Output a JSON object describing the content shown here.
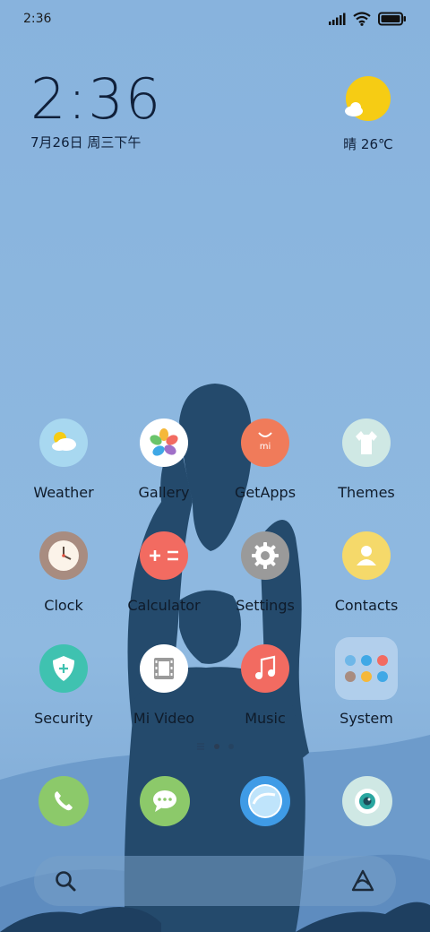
{
  "status_bar": {
    "time": "2:36"
  },
  "clock_widget": {
    "time": "2:36",
    "date": "7月26日 周三下午"
  },
  "weather_widget": {
    "condition_temp": "晴 26℃",
    "icon": "sun-with-cloud"
  },
  "apps": [
    {
      "label": "Weather",
      "icon": "weather-icon",
      "color": "#a8d8f0"
    },
    {
      "label": "Gallery",
      "icon": "gallery-flower-icon",
      "color": "#ffffff"
    },
    {
      "label": "GetApps",
      "icon": "getapps-bag-icon",
      "color": "#f07b5a"
    },
    {
      "label": "Themes",
      "icon": "themes-shirt-icon",
      "color": "#cfe8e4"
    },
    {
      "label": "Clock",
      "icon": "clock-icon",
      "color": "#a88c80"
    },
    {
      "label": "Calculator",
      "icon": "calculator-icon",
      "color": "#f26b61"
    },
    {
      "label": "Settings",
      "icon": "gear-icon",
      "color": "#9a9a9a"
    },
    {
      "label": "Contacts",
      "icon": "contact-person-icon",
      "color": "#f5d96a"
    },
    {
      "label": "Security",
      "icon": "shield-plus-icon",
      "color": "#3fc2b0"
    },
    {
      "label": "Mi Video",
      "icon": "film-icon",
      "color": "#ffffff"
    },
    {
      "label": "Music",
      "icon": "music-note-icon",
      "color": "#f26b61"
    },
    {
      "label": "System",
      "icon": "folder-icon",
      "color": "#cfe0f2"
    }
  ],
  "dock": [
    {
      "icon": "phone-icon",
      "color": "#8cc96a"
    },
    {
      "icon": "messages-icon",
      "color": "#8cc96a"
    },
    {
      "icon": "browser-icon",
      "color": "#3f9be6"
    },
    {
      "icon": "camera-icon",
      "color": "#cfe8e4"
    }
  ]
}
